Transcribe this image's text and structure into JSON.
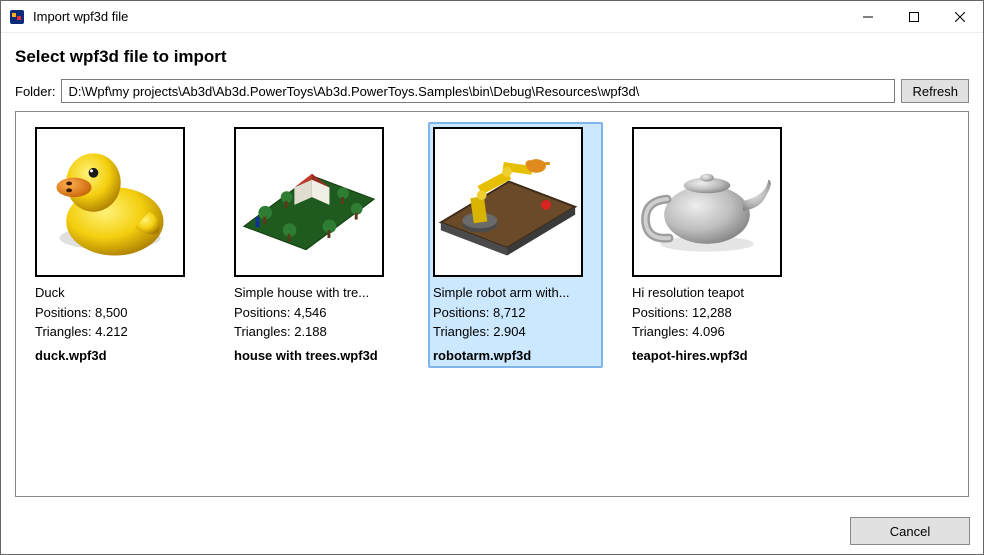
{
  "window": {
    "title": "Import wpf3d file"
  },
  "subtitle": "Select wpf3d file to import",
  "folder": {
    "label": "Folder:",
    "path": "D:\\Wpf\\my projects\\Ab3d\\Ab3d.PowerToys\\Ab3d.PowerToys.Samples\\bin\\Debug\\Resources\\wpf3d\\",
    "refresh_label": "Refresh"
  },
  "items": [
    {
      "name": "Duck",
      "positions": "Positions: 8,500",
      "triangles": "Triangles: 4.212",
      "filename": "duck.wpf3d",
      "selected": false
    },
    {
      "name": "Simple house with tre...",
      "positions": "Positions: 4,546",
      "triangles": "Triangles: 2.188",
      "filename": "house with trees.wpf3d",
      "selected": false
    },
    {
      "name": "Simple robot arm with...",
      "positions": "Positions: 8,712",
      "triangles": "Triangles: 2.904",
      "filename": "robotarm.wpf3d",
      "selected": true
    },
    {
      "name": "Hi resolution teapot",
      "positions": "Positions: 12,288",
      "triangles": "Triangles: 4.096",
      "filename": "teapot-hires.wpf3d",
      "selected": false
    }
  ],
  "cancel_label": "Cancel"
}
